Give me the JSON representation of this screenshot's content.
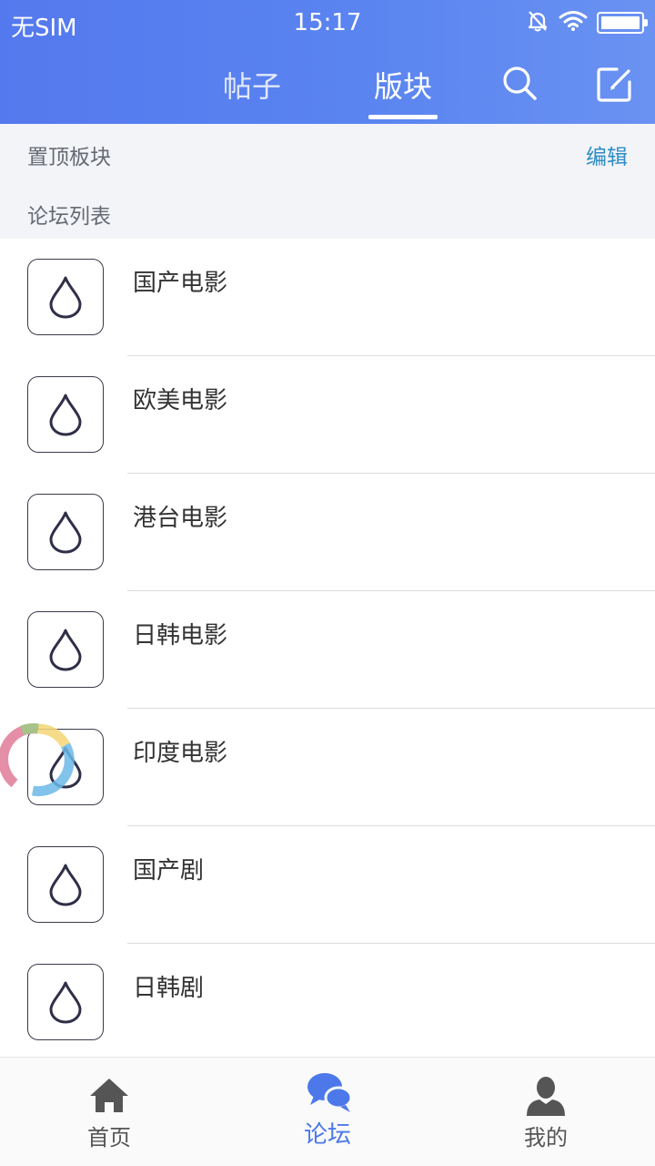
{
  "status_bar": {
    "carrier": "无SIM",
    "time": "15:17",
    "icons": [
      "mute-bell-icon",
      "wifi-icon",
      "battery-icon"
    ]
  },
  "nav": {
    "tabs": [
      {
        "label": "帖子",
        "active": false
      },
      {
        "label": "版块",
        "active": true
      }
    ],
    "icons": [
      "search-icon",
      "compose-icon"
    ]
  },
  "sections": {
    "pinned": {
      "label": "置顶板块",
      "action": "编辑"
    },
    "forum_list": {
      "label": "论坛列表"
    }
  },
  "forums": [
    {
      "name": "国产电影",
      "icon": "droplet-icon"
    },
    {
      "name": "欧美电影",
      "icon": "droplet-icon"
    },
    {
      "name": "港台电影",
      "icon": "droplet-icon"
    },
    {
      "name": "日韩电影",
      "icon": "droplet-icon"
    },
    {
      "name": "印度电影",
      "icon": "droplet-icon"
    },
    {
      "name": "国产剧",
      "icon": "droplet-icon"
    },
    {
      "name": "日韩剧",
      "icon": "droplet-icon"
    }
  ],
  "tabbar": {
    "items": [
      {
        "label": "首页",
        "icon": "home-icon",
        "active": false
      },
      {
        "label": "论坛",
        "icon": "chat-bubbles-icon",
        "active": true
      },
      {
        "label": "我的",
        "icon": "user-icon",
        "active": false
      }
    ]
  },
  "colors": {
    "header": "#5479ee",
    "accent_link": "#2d8cc4",
    "active_tab": "#4c78ea",
    "section_bg": "#f3f4f8"
  }
}
